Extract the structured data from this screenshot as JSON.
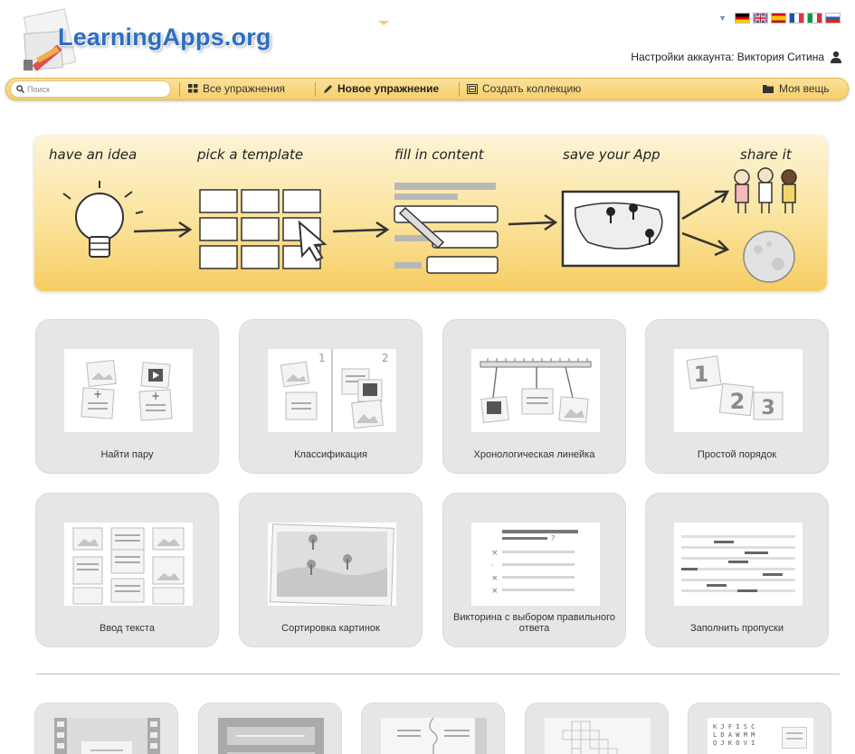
{
  "header": {
    "logo_text": "LearningApps.org",
    "account_label": "Настройки аккаунта: Виктория Ситина",
    "flags": [
      "de",
      "gb",
      "es",
      "fr",
      "it",
      "ru"
    ],
    "colors": {
      "logo": "#2b6fc4",
      "navbar": "#f6cf6a",
      "banner": "#fbe39c",
      "card": "#e6e6e6"
    }
  },
  "nav": {
    "search_placeholder": "Поиск",
    "all_exercises": "Все упражнения",
    "new_exercise": "Новое упражнение",
    "create_collection": "Создать коллекцию",
    "my_stuff": "Моя вещь"
  },
  "banner": {
    "steps": [
      "have an idea",
      "pick a template",
      "fill in content",
      "save your App",
      "share it"
    ]
  },
  "cards": [
    {
      "title": "Найти пару",
      "icon": "matching-pairs-icon"
    },
    {
      "title": "Классификация",
      "icon": "group-assignment-icon"
    },
    {
      "title": "Хронологическая линейка",
      "icon": "timeline-icon"
    },
    {
      "title": "Простой порядок",
      "icon": "simple-order-icon"
    },
    {
      "title": "Ввод текста",
      "icon": "text-input-icon"
    },
    {
      "title": "Сортировка картинок",
      "icon": "pin-on-image-icon"
    },
    {
      "title": "Викторина с выбором правильного ответа",
      "icon": "multiple-choice-icon"
    },
    {
      "title": "Заполнить пропуски",
      "icon": "fill-blanks-icon"
    }
  ],
  "more_cards": [
    {
      "icon": "video-film-icon"
    },
    {
      "icon": "text-cards-icon"
    },
    {
      "icon": "puzzle-icon"
    },
    {
      "icon": "crossword-icon"
    },
    {
      "icon": "word-grid-icon",
      "letters": [
        "K J F I S C",
        "L D A W M M",
        "Q J K O V I"
      ]
    }
  ]
}
